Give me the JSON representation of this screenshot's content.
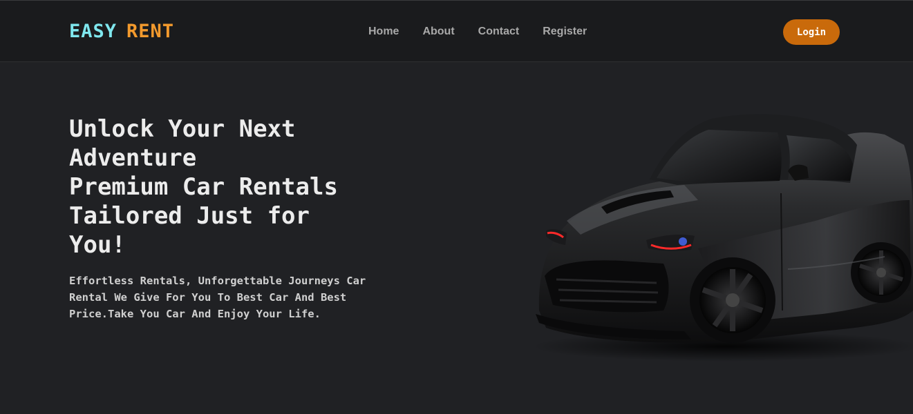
{
  "brand": {
    "part1": "EASY",
    "part2": "RENT"
  },
  "nav": {
    "links": [
      "Home",
      "About",
      "Contact",
      "Register"
    ],
    "login_label": "Login"
  },
  "hero": {
    "title_lines": [
      "Unlock Your Next",
      "Adventure",
      "Premium Car Rentals",
      "Tailored Just for",
      "You!"
    ],
    "description": "Effortless Rentals, Unforgettable Journeys Car Rental We Give For You To Best Car And Best Price.Take You Car And Enjoy Your Life."
  },
  "colors": {
    "background": "#202124",
    "navbar": "#1a1b1d",
    "logo_primary": "#7fe7ee",
    "logo_accent": "#f39a2d",
    "login_button": "#c96a0b"
  },
  "icons": {
    "hero_image": "black-sports-car"
  }
}
